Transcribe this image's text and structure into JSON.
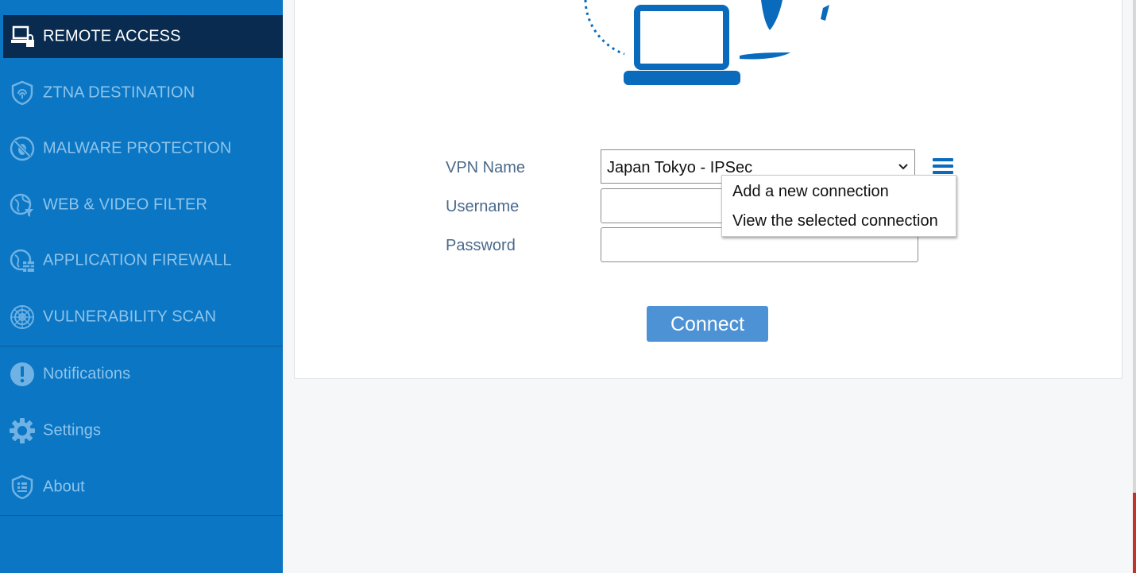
{
  "sidebar": {
    "items": [
      {
        "label": "REMOTE ACCESS",
        "icon": "laptop-lock-icon",
        "active": true
      },
      {
        "label": "ZTNA DESTINATION",
        "icon": "shield-fingerprint-icon"
      },
      {
        "label": "MALWARE PROTECTION",
        "icon": "malware-block-icon"
      },
      {
        "label": "WEB & VIDEO FILTER",
        "icon": "globe-filter-icon"
      },
      {
        "label": "APPLICATION FIREWALL",
        "icon": "globe-firewall-icon"
      },
      {
        "label": "VULNERABILITY SCAN",
        "icon": "radar-icon"
      }
    ],
    "secondary": [
      {
        "label": "Notifications",
        "icon": "exclamation-icon"
      },
      {
        "label": "Settings",
        "icon": "gear-icon"
      },
      {
        "label": "About",
        "icon": "shield-info-icon"
      }
    ]
  },
  "form": {
    "vpn_name_label": "VPN Name",
    "vpn_name_value": "Japan Tokyo - IPSec",
    "username_label": "Username",
    "password_label": "Password",
    "connect_label": "Connect"
  },
  "menu": {
    "items": [
      "Add a new connection",
      "View the selected connection"
    ]
  },
  "colors": {
    "sidebar": "#0a76c4",
    "sidebar_active": "#082b4f",
    "button": "#4e92d6"
  }
}
